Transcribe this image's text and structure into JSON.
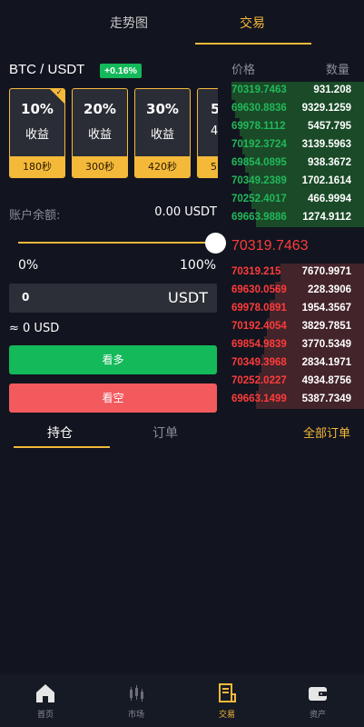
{
  "top_tabs": {
    "trend": "走势图",
    "trade": "交易"
  },
  "pair": {
    "name": "BTC / USDT",
    "change": "+0.16%"
  },
  "cards": [
    {
      "pct": "10%",
      "label": "收益",
      "time": "180秒"
    },
    {
      "pct": "20%",
      "label": "收益",
      "time": "300秒"
    },
    {
      "pct": "30%",
      "label": "收益",
      "time": "420秒"
    },
    {
      "pct": "5",
      "label": "4",
      "time": "5"
    }
  ],
  "balance": {
    "label": "账户余额:",
    "value": "0.00 USDT"
  },
  "slider": {
    "min_label": "0%",
    "max_label": "100%",
    "value": 100
  },
  "amount": {
    "value": "0",
    "unit": "USDT"
  },
  "approx": "≈ 0 USD",
  "buttons": {
    "long": "看多",
    "short": "看空"
  },
  "sub_tabs": {
    "positions": "持仓",
    "orders": "订单",
    "all_orders": "全部订单"
  },
  "order_book": {
    "price_header": "价格",
    "qty_header": "数量",
    "mid_price": "70319.7463",
    "bids": [
      {
        "price": "70319.7463",
        "qty": "931.208",
        "depth": 0.98
      },
      {
        "price": "69630.8836",
        "qty": "9329.1259",
        "depth": 0.95
      },
      {
        "price": "69978.1112",
        "qty": "5457.795",
        "depth": 0.92
      },
      {
        "price": "70192.3724",
        "qty": "3139.5963",
        "depth": 0.9
      },
      {
        "price": "69854.0895",
        "qty": "938.3672",
        "depth": 0.88
      },
      {
        "price": "70349.2389",
        "qty": "1702.1614",
        "depth": 0.85
      },
      {
        "price": "70252.4017",
        "qty": "466.9994",
        "depth": 0.83
      },
      {
        "price": "69663.9886",
        "qty": "1274.9112",
        "depth": 0.8
      }
    ],
    "asks": [
      {
        "price": "70319.215",
        "qty": "7670.9971",
        "depth": 0.62
      },
      {
        "price": "69630.0569",
        "qty": "228.3906",
        "depth": 0.66
      },
      {
        "price": "69978.0891",
        "qty": "1954.3567",
        "depth": 0.7
      },
      {
        "price": "70192.4054",
        "qty": "3829.7851",
        "depth": 0.72
      },
      {
        "price": "69854.9839",
        "qty": "3770.5349",
        "depth": 0.74
      },
      {
        "price": "70349.3968",
        "qty": "2834.1971",
        "depth": 0.76
      },
      {
        "price": "70252.0227",
        "qty": "4934.8756",
        "depth": 0.78
      },
      {
        "price": "69663.1499",
        "qty": "5387.7349",
        "depth": 0.8
      }
    ]
  },
  "nav": [
    {
      "label": "首页",
      "icon": "home-icon"
    },
    {
      "label": "市场",
      "icon": "candlestick-icon"
    },
    {
      "label": "交易",
      "icon": "trade-document-icon"
    },
    {
      "label": "资产",
      "icon": "wallet-icon"
    }
  ],
  "colors": {
    "accent": "#f5b93a",
    "up": "#22b85a",
    "down": "#ff3b3b",
    "bg": "#12151f"
  }
}
